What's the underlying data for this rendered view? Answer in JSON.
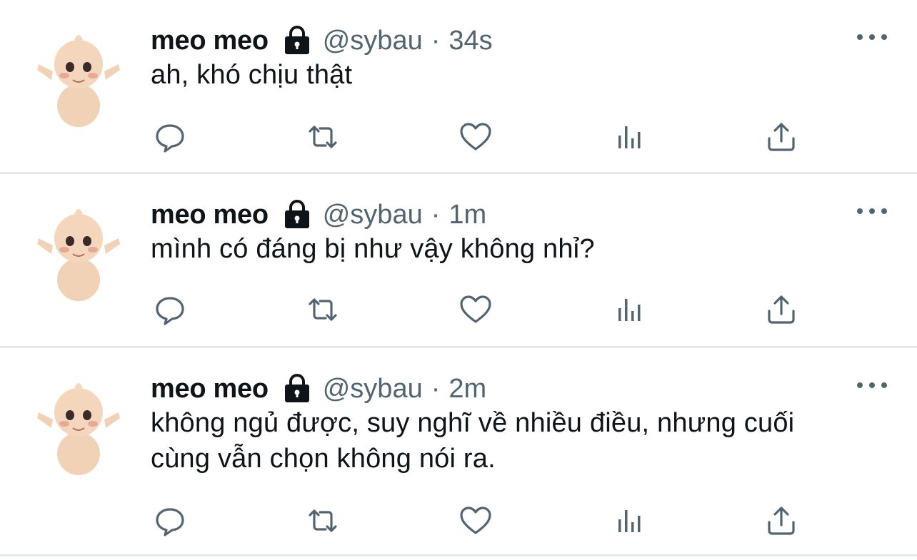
{
  "tweets": [
    {
      "name": "meo meo",
      "handle": "@sybau",
      "separator": "·",
      "time": "34s",
      "lines": [
        "ah, khó chịu thật"
      ]
    },
    {
      "name": "meo meo",
      "handle": "@sybau",
      "separator": "·",
      "time": "1m",
      "lines": [
        "mình có đáng bị như vậy không nhỉ?"
      ]
    },
    {
      "name": "meo meo",
      "handle": "@sybau",
      "separator": "·",
      "time": "2m",
      "lines": [
        "không ngủ được, suy nghĩ về nhiều điều, nhưng cuối",
        "cùng vẫn chọn không nói ra."
      ]
    }
  ],
  "icons": {
    "lock": "lock-icon",
    "more": "more-icon",
    "reply": "reply-icon",
    "retweet": "retweet-icon",
    "like": "heart-icon",
    "views": "views-icon",
    "share": "share-icon"
  },
  "colors": {
    "text": "#0f1419",
    "secondary": "#536471",
    "divider": "#e6e9ec",
    "background": "#ffffff"
  }
}
